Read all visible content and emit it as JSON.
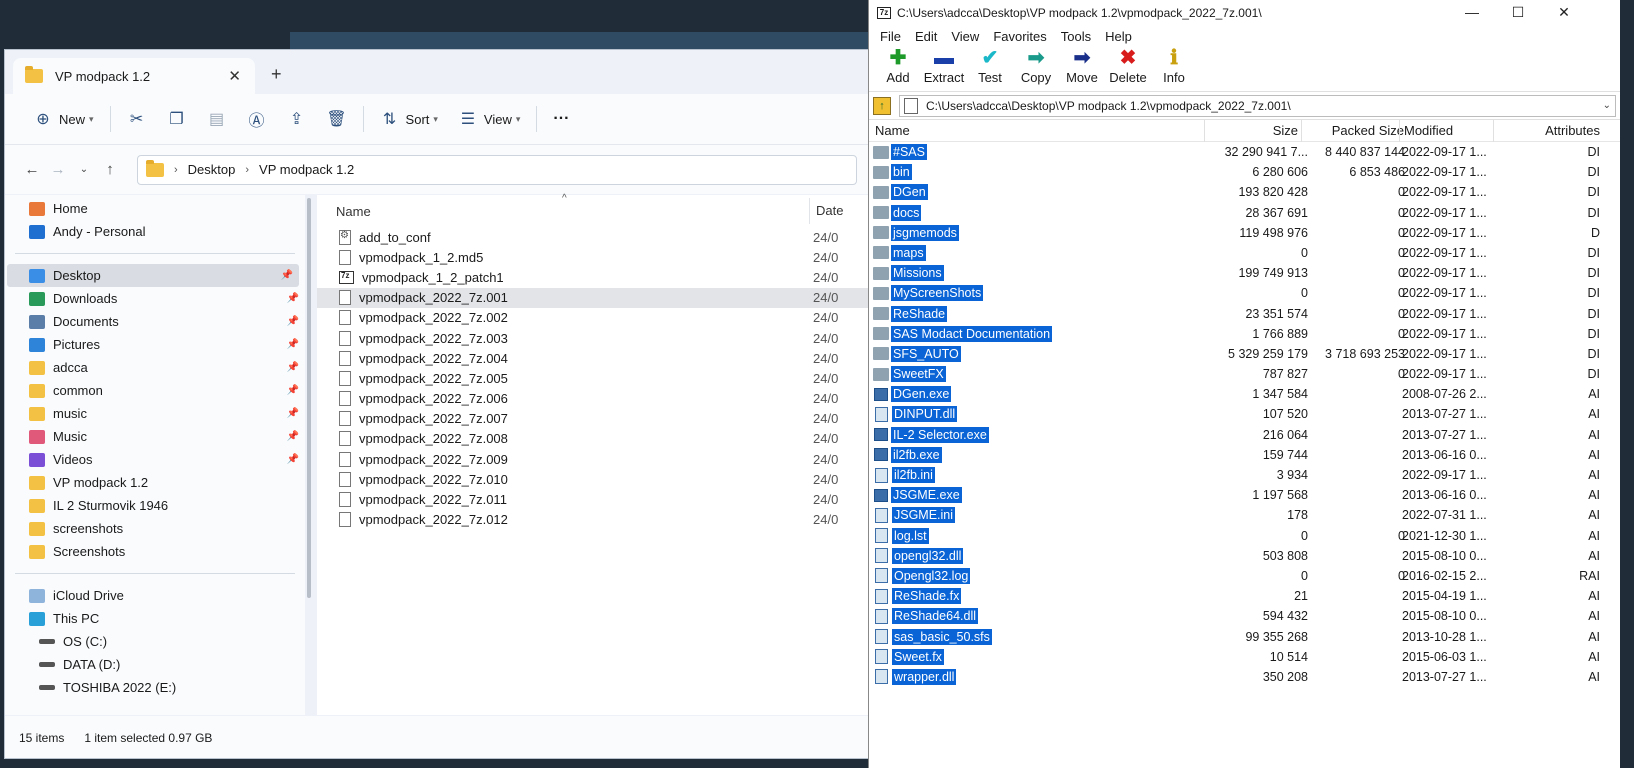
{
  "explorer": {
    "tab_title": "VP modpack 1.2",
    "toolbar": {
      "new_label": "New",
      "sort_label": "Sort",
      "view_label": "View",
      "more_label": "···"
    },
    "breadcrumb": [
      "Desktop",
      "VP modpack 1.2"
    ],
    "sidebar": {
      "top": [
        {
          "label": "Home",
          "icon": "home-icon",
          "color": "#e8793a"
        },
        {
          "label": "Andy - Personal",
          "icon": "onedrive-icon",
          "color": "#1f6fd1"
        }
      ],
      "quick": [
        {
          "label": "Desktop",
          "icon": "desktop-icon",
          "color": "#3a8ee6",
          "pinned": true,
          "selected": true
        },
        {
          "label": "Downloads",
          "icon": "downloads-icon",
          "color": "#2a9a5a",
          "pinned": true
        },
        {
          "label": "Documents",
          "icon": "documents-icon",
          "color": "#5a7ea8",
          "pinned": true
        },
        {
          "label": "Pictures",
          "icon": "pictures-icon",
          "color": "#2d84d9",
          "pinned": true
        },
        {
          "label": "adcca",
          "icon": "folder-icon",
          "color": "#f3c245",
          "pinned": true
        },
        {
          "label": "common",
          "icon": "folder-icon",
          "color": "#f3c245",
          "pinned": true
        },
        {
          "label": "music",
          "icon": "folder-icon",
          "color": "#f3c245",
          "pinned": true
        },
        {
          "label": "Music",
          "icon": "music-icon",
          "color": "#e0587a",
          "pinned": true
        },
        {
          "label": "Videos",
          "icon": "videos-icon",
          "color": "#7b4fd6",
          "pinned": true
        },
        {
          "label": "VP modpack 1.2",
          "icon": "folder-icon",
          "color": "#f3c245"
        },
        {
          "label": "IL 2 Sturmovik 1946",
          "icon": "folder-icon",
          "color": "#f3c245"
        },
        {
          "label": "screenshots",
          "icon": "folder-icon",
          "color": "#f3c245"
        },
        {
          "label": "Screenshots",
          "icon": "folder-icon",
          "color": "#f3c245"
        }
      ],
      "bottom": [
        {
          "label": "iCloud Drive",
          "icon": "icloud-icon",
          "color": "#8fb4dc"
        },
        {
          "label": "This PC",
          "icon": "pc-icon",
          "color": "#2aa0d8"
        },
        {
          "label": "OS (C:)",
          "icon": "drive-icon",
          "color": "#555555",
          "sub": true
        },
        {
          "label": "DATA (D:)",
          "icon": "drive-icon",
          "color": "#555555",
          "sub": true
        },
        {
          "label": "TOSHIBA 2022 (E:)",
          "icon": "drive-icon",
          "color": "#555555",
          "sub": true
        }
      ]
    },
    "columns": {
      "name": "Name",
      "date": "Date"
    },
    "files": [
      {
        "name": "add_to_conf",
        "date": "24/0",
        "icon": "config"
      },
      {
        "name": "vpmodpack_1_2.md5",
        "date": "24/0",
        "icon": "doc"
      },
      {
        "name": "vpmodpack_1_2_patch1",
        "date": "24/0",
        "icon": "7z"
      },
      {
        "name": "vpmodpack_2022_7z.001",
        "date": "24/0",
        "icon": "doc",
        "selected": true
      },
      {
        "name": "vpmodpack_2022_7z.002",
        "date": "24/0",
        "icon": "doc"
      },
      {
        "name": "vpmodpack_2022_7z.003",
        "date": "24/0",
        "icon": "doc"
      },
      {
        "name": "vpmodpack_2022_7z.004",
        "date": "24/0",
        "icon": "doc"
      },
      {
        "name": "vpmodpack_2022_7z.005",
        "date": "24/0",
        "icon": "doc"
      },
      {
        "name": "vpmodpack_2022_7z.006",
        "date": "24/0",
        "icon": "doc"
      },
      {
        "name": "vpmodpack_2022_7z.007",
        "date": "24/0",
        "icon": "doc"
      },
      {
        "name": "vpmodpack_2022_7z.008",
        "date": "24/0",
        "icon": "doc"
      },
      {
        "name": "vpmodpack_2022_7z.009",
        "date": "24/0",
        "icon": "doc"
      },
      {
        "name": "vpmodpack_2022_7z.010",
        "date": "24/0",
        "icon": "doc"
      },
      {
        "name": "vpmodpack_2022_7z.011",
        "date": "24/0",
        "icon": "doc"
      },
      {
        "name": "vpmodpack_2022_7z.012",
        "date": "24/0",
        "icon": "doc"
      }
    ],
    "status": {
      "items": "15 items",
      "selected": "1 item selected  0.97 GB"
    }
  },
  "zip": {
    "title": "C:\\Users\\adcca\\Desktop\\VP modpack 1.2\\vpmodpack_2022_7z.001\\",
    "menu": [
      "File",
      "Edit",
      "View",
      "Favorites",
      "Tools",
      "Help"
    ],
    "tools": [
      {
        "label": "Add",
        "icon": "add-icon",
        "glyph": "✚",
        "color": "#1e9a2a"
      },
      {
        "label": "Extract",
        "icon": "extract-icon",
        "glyph": "▬",
        "color": "#1a3fa8"
      },
      {
        "label": "Test",
        "icon": "test-icon",
        "glyph": "✔",
        "color": "#1ab8c8"
      },
      {
        "label": "Copy",
        "icon": "copy-icon",
        "glyph": "➡",
        "color": "#1a9a8a"
      },
      {
        "label": "Move",
        "icon": "move-icon",
        "glyph": "➡",
        "color": "#1a2f8a"
      },
      {
        "label": "Delete",
        "icon": "delete-icon",
        "glyph": "✖",
        "color": "#d81c1c"
      },
      {
        "label": "Info",
        "icon": "info-icon",
        "glyph": "ℹ",
        "color": "#c8a010"
      }
    ],
    "path": "C:\\Users\\adcca\\Desktop\\VP modpack 1.2\\vpmodpack_2022_7z.001\\",
    "columns": {
      "name": "Name",
      "size": "Size",
      "packed": "Packed Size",
      "modified": "Modified",
      "attributes": "Attributes"
    },
    "rows": [
      {
        "name": "#SAS",
        "type": "folder",
        "size": "32 290 941 7...",
        "packed": "8 440 837 144",
        "modified": "2022-09-17 1...",
        "attr": "DI"
      },
      {
        "name": "bin",
        "type": "folder",
        "size": "6 280 606",
        "packed": "6 853 486",
        "modified": "2022-09-17 1...",
        "attr": "DI"
      },
      {
        "name": "DGen",
        "type": "folder",
        "size": "193 820 428",
        "packed": "0",
        "modified": "2022-09-17 1...",
        "attr": "DI"
      },
      {
        "name": "docs",
        "type": "folder",
        "size": "28 367 691",
        "packed": "0",
        "modified": "2022-09-17 1...",
        "attr": "DI"
      },
      {
        "name": "jsgmemods",
        "type": "folder",
        "size": "119 498 976",
        "packed": "0",
        "modified": "2022-09-17 1...",
        "attr": "D"
      },
      {
        "name": "maps",
        "type": "folder",
        "size": "0",
        "packed": "0",
        "modified": "2022-09-17 1...",
        "attr": "DI"
      },
      {
        "name": "Missions",
        "type": "folder",
        "size": "199 749 913",
        "packed": "0",
        "modified": "2022-09-17 1...",
        "attr": "DI"
      },
      {
        "name": "MyScreenShots",
        "type": "folder",
        "size": "0",
        "packed": "0",
        "modified": "2022-09-17 1...",
        "attr": "DI"
      },
      {
        "name": "ReShade",
        "type": "folder",
        "size": "23 351 574",
        "packed": "0",
        "modified": "2022-09-17 1...",
        "attr": "DI"
      },
      {
        "name": "SAS Modact Documentation",
        "type": "folder",
        "size": "1 766 889",
        "packed": "0",
        "modified": "2022-09-17 1...",
        "attr": "DI"
      },
      {
        "name": "SFS_AUTO",
        "type": "folder",
        "size": "5 329 259 179",
        "packed": "3 718 693 253",
        "modified": "2022-09-17 1...",
        "attr": "DI"
      },
      {
        "name": "SweetFX",
        "type": "folder",
        "size": "787 827",
        "packed": "0",
        "modified": "2022-09-17 1...",
        "attr": "DI"
      },
      {
        "name": "DGen.exe",
        "type": "exe",
        "size": "1 347 584",
        "packed": "",
        "modified": "2008-07-26 2...",
        "attr": "AI"
      },
      {
        "name": "DINPUT.dll",
        "type": "file",
        "size": "107 520",
        "packed": "",
        "modified": "2013-07-27 1...",
        "attr": "AI"
      },
      {
        "name": "IL-2 Selector.exe",
        "type": "exe",
        "size": "216 064",
        "packed": "",
        "modified": "2013-07-27 1...",
        "attr": "AI"
      },
      {
        "name": "il2fb.exe",
        "type": "exe",
        "size": "159 744",
        "packed": "",
        "modified": "2013-06-16 0...",
        "attr": "AI"
      },
      {
        "name": "il2fb.ini",
        "type": "file",
        "size": "3 934",
        "packed": "",
        "modified": "2022-09-17 1...",
        "attr": "AI"
      },
      {
        "name": "JSGME.exe",
        "type": "exe",
        "size": "1 197 568",
        "packed": "",
        "modified": "2013-06-16 0...",
        "attr": "AI"
      },
      {
        "name": "JSGME.ini",
        "type": "file",
        "size": "178",
        "packed": "",
        "modified": "2022-07-31 1...",
        "attr": "AI"
      },
      {
        "name": "log.lst",
        "type": "file",
        "size": "0",
        "packed": "0",
        "modified": "2021-12-30 1...",
        "attr": "AI"
      },
      {
        "name": "opengl32.dll",
        "type": "file",
        "size": "503 808",
        "packed": "",
        "modified": "2015-08-10 0...",
        "attr": "AI"
      },
      {
        "name": "Opengl32.log",
        "type": "file",
        "size": "0",
        "packed": "0",
        "modified": "2016-02-15 2...",
        "attr": "RAI"
      },
      {
        "name": "ReShade.fx",
        "type": "file",
        "size": "21",
        "packed": "",
        "modified": "2015-04-19 1...",
        "attr": "AI"
      },
      {
        "name": "ReShade64.dll",
        "type": "file",
        "size": "594 432",
        "packed": "",
        "modified": "2015-08-10 0...",
        "attr": "AI"
      },
      {
        "name": "sas_basic_50.sfs",
        "type": "file",
        "size": "99 355 268",
        "packed": "",
        "modified": "2013-10-28 1...",
        "attr": "AI"
      },
      {
        "name": "Sweet.fx",
        "type": "file",
        "size": "10 514",
        "packed": "",
        "modified": "2015-06-03 1...",
        "attr": "AI"
      },
      {
        "name": "wrapper.dll",
        "type": "file",
        "size": "350 208",
        "packed": "",
        "modified": "2013-07-27 1...",
        "attr": "AI"
      }
    ]
  }
}
